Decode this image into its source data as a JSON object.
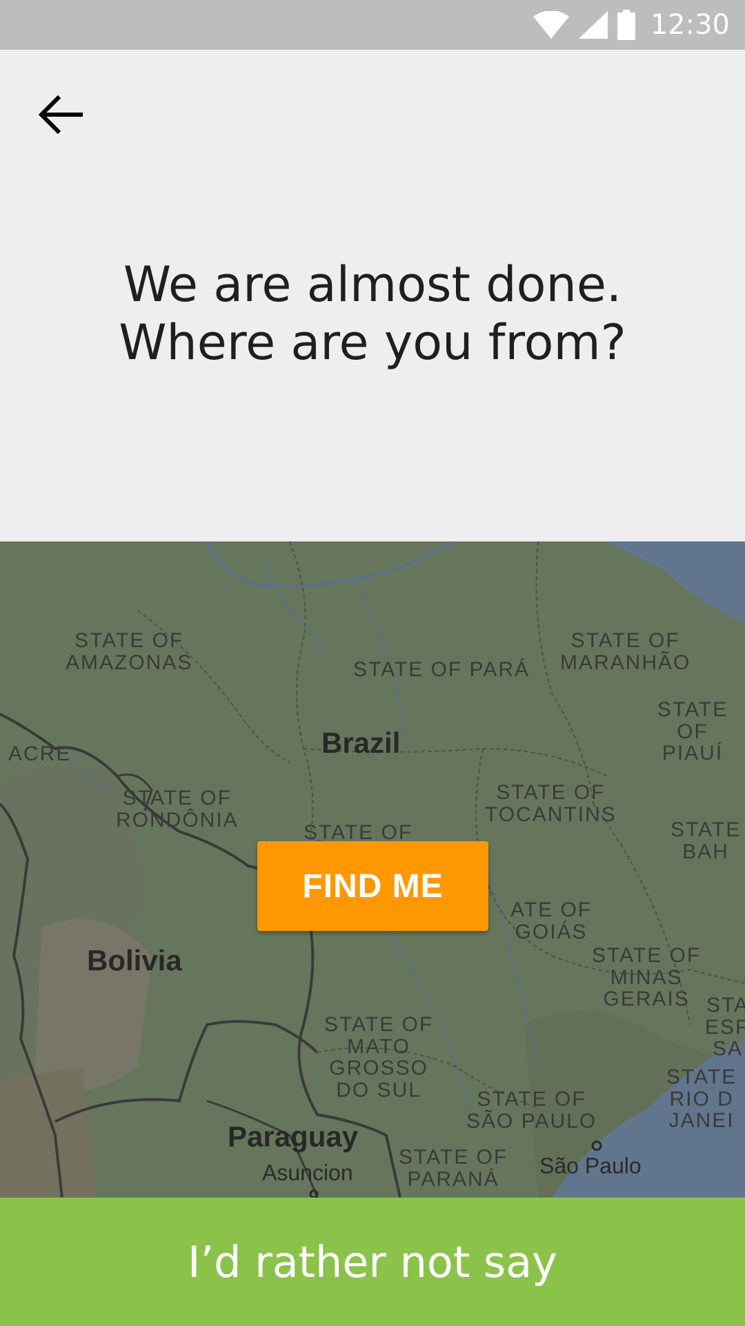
{
  "status_bar": {
    "time": "12:30",
    "icons": [
      "wifi-icon",
      "cell-signal-icon",
      "battery-icon"
    ]
  },
  "header": {
    "back_icon": "arrow-left-icon"
  },
  "headline": {
    "line1": "We are almost done.",
    "line2": "Where are you from?"
  },
  "map": {
    "labels": {
      "amazonas": [
        "STATE OF",
        "AMAZONAS"
      ],
      "para": "STATE OF PARÁ",
      "maranhao": [
        "STATE OF",
        "MARANHÃO"
      ],
      "piaui": [
        "STATE OF",
        "PIAUÍ"
      ],
      "acre": "ACRE",
      "brazil": "Brazil",
      "rondonia": [
        "STATE OF",
        "RONDÔNIA"
      ],
      "mato_grosso": "STATE OF",
      "tocantins": [
        "STATE OF",
        "TOCANTINS"
      ],
      "bahia": [
        "STATE",
        "BAH"
      ],
      "goias": [
        "ATE OF",
        "GOIÁS"
      ],
      "bolivia": "Bolivia",
      "minas_gerais": [
        "STATE OF",
        "MINAS",
        "GERAIS"
      ],
      "espirito_santo": [
        "STA",
        "ESP",
        "SA"
      ],
      "mato_grosso_do_sul": [
        "STATE OF",
        "MATO",
        "GROSSO",
        "DO SUL"
      ],
      "rio": [
        "STATE",
        "RIO D",
        "JANEI"
      ],
      "sao_paulo_state": [
        "STATE OF",
        "SÃO PAULO"
      ],
      "paraguay": "Paraguay",
      "asuncion": "Asuncion",
      "parana": [
        "STATE OF",
        "PARANÁ"
      ],
      "sao_paulo_city": "São Paulo"
    }
  },
  "find_me_button": {
    "label": "FIND ME"
  },
  "bottom_button": {
    "label": "I’d rather not say"
  },
  "colors": {
    "status_bar": "#bdbdbd",
    "background": "#eeeeee",
    "accent_orange": "#ff9800",
    "bottom_green": "#8bc34a"
  }
}
